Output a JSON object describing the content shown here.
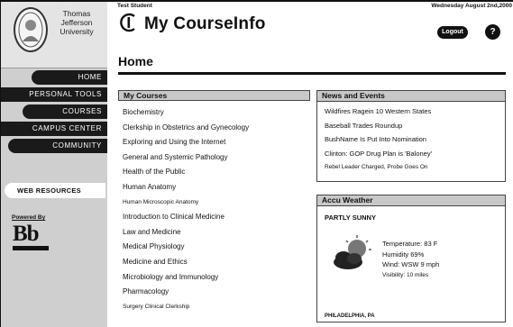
{
  "university": {
    "name_lines": [
      "Thomas",
      "Jefferson",
      "University"
    ]
  },
  "nav": {
    "items": [
      {
        "label": "HOME"
      },
      {
        "label": "PERSONAL TOOLS"
      },
      {
        "label": "COURSES"
      },
      {
        "label": "CAMPUS CENTER"
      },
      {
        "label": "COMMUNITY"
      }
    ],
    "web_resources": "WEB RESOURCES",
    "powered_by": "Powered By",
    "blackboard_logo_text": "Bb"
  },
  "header": {
    "user": "Test Student",
    "app_title": "My CourseInfo",
    "date": "Wednesday August 2nd,2000",
    "logout_label": "Logout",
    "help_label": "?"
  },
  "page": {
    "title": "Home"
  },
  "courses": {
    "heading": "My Courses",
    "items": [
      "Biochemistry",
      "Clerkship in Obstetrics and Gynecology",
      "Exploring and Using the Internet",
      "General and Systemic Pathology",
      "Health of the Public",
      "Human Anatomy",
      "Human Microscopic Anatomy",
      "Introduction to Clinical Medicine",
      "Law and Medicine",
      "Medical Physiology",
      "Medicine and Ethics",
      "Microbiology and Immunology",
      "Pharmacology",
      "Surgery Clinical Clerkship"
    ]
  },
  "news": {
    "heading": "News and Events",
    "items": [
      "Wildfires Ragein 10 Western States",
      "Baseball Trades Roundup",
      "BushName Is Put Into Nomination",
      "Clinton: GOP Drug Plan is 'Baloney'",
      "Rebel Leader Charged, Probe Goes On"
    ]
  },
  "weather": {
    "heading": "Accu Weather",
    "condition": "PARTLY SUNNY",
    "temperature": "Temperature: 83 F",
    "humidity": "Humidity 69%",
    "wind": "Wind: WSW 9 mph",
    "visibility": "Visibility: 10 miles",
    "location": "PHILADELPHIA, PA",
    "icon": "partly-sunny-icon"
  }
}
